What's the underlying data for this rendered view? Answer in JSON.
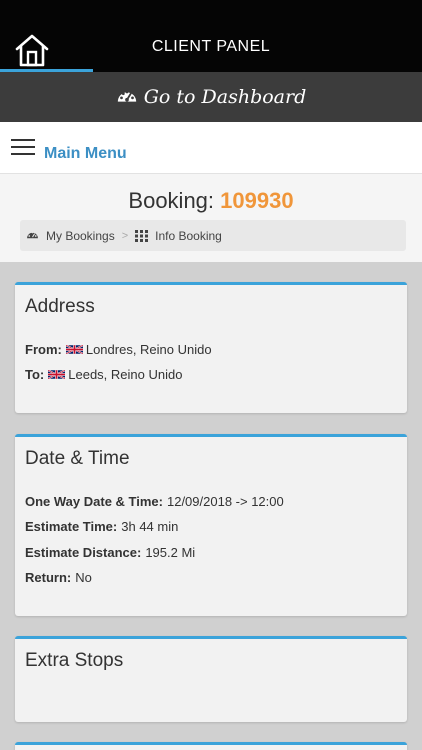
{
  "topbar": {
    "title": "CLIENT PANEL",
    "home_icon": "home-icon"
  },
  "dashboard": {
    "label": "Go to Dashboard",
    "icon": "dashboard-gauge-icon"
  },
  "menu": {
    "label": "Main Menu",
    "icon": "hamburger-icon"
  },
  "booking": {
    "prefix": "Booking:",
    "number": "109930"
  },
  "breadcrumb": [
    {
      "label": "My Bookings",
      "icon": "dashboard-gauge-icon"
    },
    {
      "separator": ">"
    },
    {
      "label": "Info Booking",
      "icon": "grid-icon"
    }
  ],
  "address": {
    "title": "Address",
    "from_label": "From:",
    "from_value": "Londres, Reino Unido",
    "to_label": "To:",
    "to_value": "Leeds, Reino Unido",
    "flag_icon": "uk-flag-icon"
  },
  "datetime": {
    "title": "Date & Time",
    "rows": [
      {
        "label": "One Way Date & Time:",
        "value": "12/09/2018 -> 12:00"
      },
      {
        "label": "Estimate Time:",
        "value": "3h 44 min"
      },
      {
        "label": "Estimate Distance:",
        "value": "195.2 Mi"
      },
      {
        "label": "Return:",
        "value": "No"
      }
    ]
  },
  "extra_stops": {
    "title": "Extra Stops"
  },
  "colors": {
    "accent": "#3ba3da",
    "booking_number": "#f0963a",
    "menu_label": "#3c8fc4",
    "topbar": "#050505",
    "dashbar": "#3c3c3c"
  }
}
